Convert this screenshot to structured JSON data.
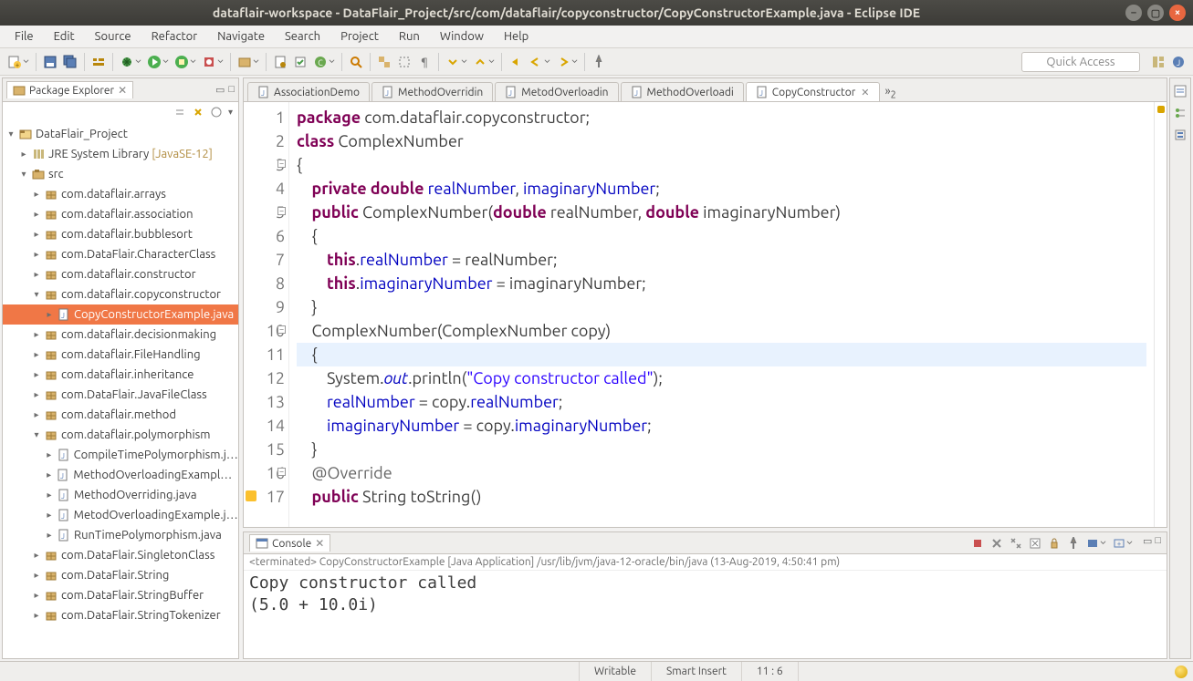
{
  "window": {
    "title": "dataflair-workspace - DataFlair_Project/src/com/dataflair/copyconstructor/CopyConstructorExample.java - Eclipse IDE"
  },
  "menu": [
    "File",
    "Edit",
    "Source",
    "Refactor",
    "Navigate",
    "Search",
    "Project",
    "Run",
    "Window",
    "Help"
  ],
  "quick_access_placeholder": "Quick Access",
  "package_explorer": {
    "title": "Package Explorer",
    "project": "DataFlair_Project",
    "jre_label": "JRE System Library",
    "jre_env": "[JavaSE-12]",
    "src_label": "src",
    "packages": [
      "com.dataflair.arrays",
      "com.dataflair.association",
      "com.dataflair.bubblesort",
      "com.DataFlair.CharacterClass",
      "com.dataflair.constructor",
      "com.dataflair.copyconstructor",
      "com.dataflair.decisionmaking",
      "com.dataflair.FileHandling",
      "com.dataflair.inheritance",
      "com.DataFlair.JavaFileClass",
      "com.dataflair.method",
      "com.dataflair.polymorphism",
      "com.DataFlair.SingletonClass",
      "com.DataFlair.String",
      "com.DataFlair.StringBuffer",
      "com.DataFlair.StringTokenizer"
    ],
    "copyconstructor_file": "CopyConstructorExample.java",
    "polymorphism_files": [
      "CompileTimePolymorphism.java",
      "MethodOverloadingExample.java",
      "MethodOverriding.java",
      "MetodOverloadingExample.java",
      "RunTimePolymorphism.java"
    ]
  },
  "editor_tabs": [
    {
      "label": "AssociationDemo",
      "active": false
    },
    {
      "label": "MethodOverridin",
      "active": false
    },
    {
      "label": "MetodOverloadin",
      "active": false
    },
    {
      "label": "MethodOverloadi",
      "active": false
    },
    {
      "label": "CopyConstructor",
      "active": true
    }
  ],
  "editor_overflow": "»₂",
  "code": {
    "lines": [
      {
        "n": "1",
        "html": "<span class='kw'>package</span> com.dataflair.copyconstructor;"
      },
      {
        "n": "2",
        "html": "<span class='kw'>class</span> ComplexNumber"
      },
      {
        "n": "3",
        "html": "{",
        "fold": true
      },
      {
        "n": "4",
        "html": "    <span class='kw'>private</span> <span class='typ'>double</span> <span class='fld'>realNumber</span>, <span class='fld'>imaginaryNumber</span>;"
      },
      {
        "n": "5",
        "html": "    <span class='kw'>public</span> ComplexNumber(<span class='typ'>double</span> realNumber, <span class='typ'>double</span> imaginaryNumber)",
        "fold": true
      },
      {
        "n": "6",
        "html": "    {"
      },
      {
        "n": "7",
        "html": "        <span class='kw'>this</span>.<span class='fld'>realNumber</span> = realNumber;"
      },
      {
        "n": "8",
        "html": "        <span class='kw'>this</span>.<span class='fld'>imaginaryNumber</span> = imaginaryNumber;"
      },
      {
        "n": "9",
        "html": "    }"
      },
      {
        "n": "10",
        "html": "    ComplexNumber(ComplexNumber copy)",
        "fold": true
      },
      {
        "n": "11",
        "html": "    {",
        "current": true
      },
      {
        "n": "12",
        "html": "        System.<span class='sta'>out</span>.println(<span class='str'>\"Copy constructor called\"</span>);"
      },
      {
        "n": "13",
        "html": "        <span class='fld'>realNumber</span> = copy.<span class='fld'>realNumber</span>;"
      },
      {
        "n": "14",
        "html": "        <span class='fld'>imaginaryNumber</span> = copy.<span class='fld'>imaginaryNumber</span>;"
      },
      {
        "n": "15",
        "html": "    }"
      },
      {
        "n": "16",
        "html": "    <span class='ann'>@Override</span>",
        "fold": true
      },
      {
        "n": "17",
        "html": "    <span class='kw'>public</span> String toString()",
        "warn": true
      }
    ]
  },
  "console": {
    "title": "Console",
    "header": "<terminated> CopyConstructorExample [Java Application] /usr/lib/jvm/java-12-oracle/bin/java (13-Aug-2019, 4:50:41 pm)",
    "output": "Copy constructor called\n(5.0 + 10.0i)"
  },
  "statusbar": {
    "writable": "Writable",
    "insert": "Smart Insert",
    "pos": "11 : 6"
  }
}
